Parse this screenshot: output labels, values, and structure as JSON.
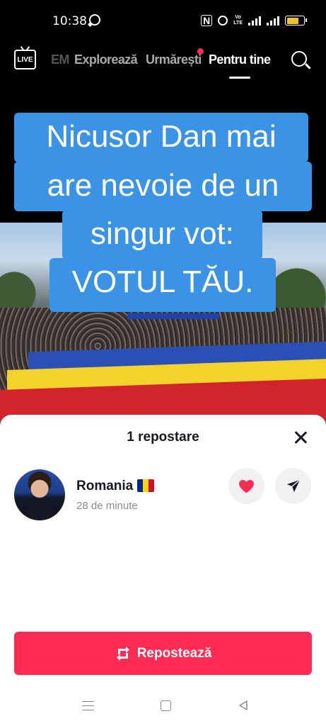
{
  "status_bar": {
    "time": "10:38",
    "icons": [
      "whatsapp-icon",
      "nfc-icon",
      "alarm-icon",
      "volte-icon",
      "signal-icon",
      "5g-signal-icon",
      "battery-icon"
    ],
    "volte_text": "Vo\nLTE",
    "battery_color": "#f2c12e"
  },
  "top_nav": {
    "live_label": "LIVE",
    "tabs": [
      {
        "label": "EM",
        "state": "partially-hidden"
      },
      {
        "label": "Explorează",
        "state": "inactive"
      },
      {
        "label": "Urmărești",
        "state": "inactive",
        "has_notification_dot": true
      },
      {
        "label": "Pentru tine",
        "state": "active"
      }
    ],
    "search_icon": "search-icon"
  },
  "video": {
    "caption_lines": [
      "Nicusor Dan mai",
      "are nevoie de un",
      "singur vot:",
      "VOTUL TĂU."
    ],
    "caption_bg": "#3a93e4"
  },
  "sheet": {
    "title": "1 repostare",
    "close_icon": "close-icon",
    "reposter": {
      "name": "Romania",
      "name_emoji": "romania-flag",
      "time_ago": "28 de minute"
    },
    "like_icon": "heart-icon",
    "send_icon": "send-icon",
    "repost_button_label": "Repostează",
    "accent": "#fe2c55"
  },
  "android_nav": {
    "icons": [
      "menu-icon",
      "home-icon",
      "back-icon"
    ]
  }
}
